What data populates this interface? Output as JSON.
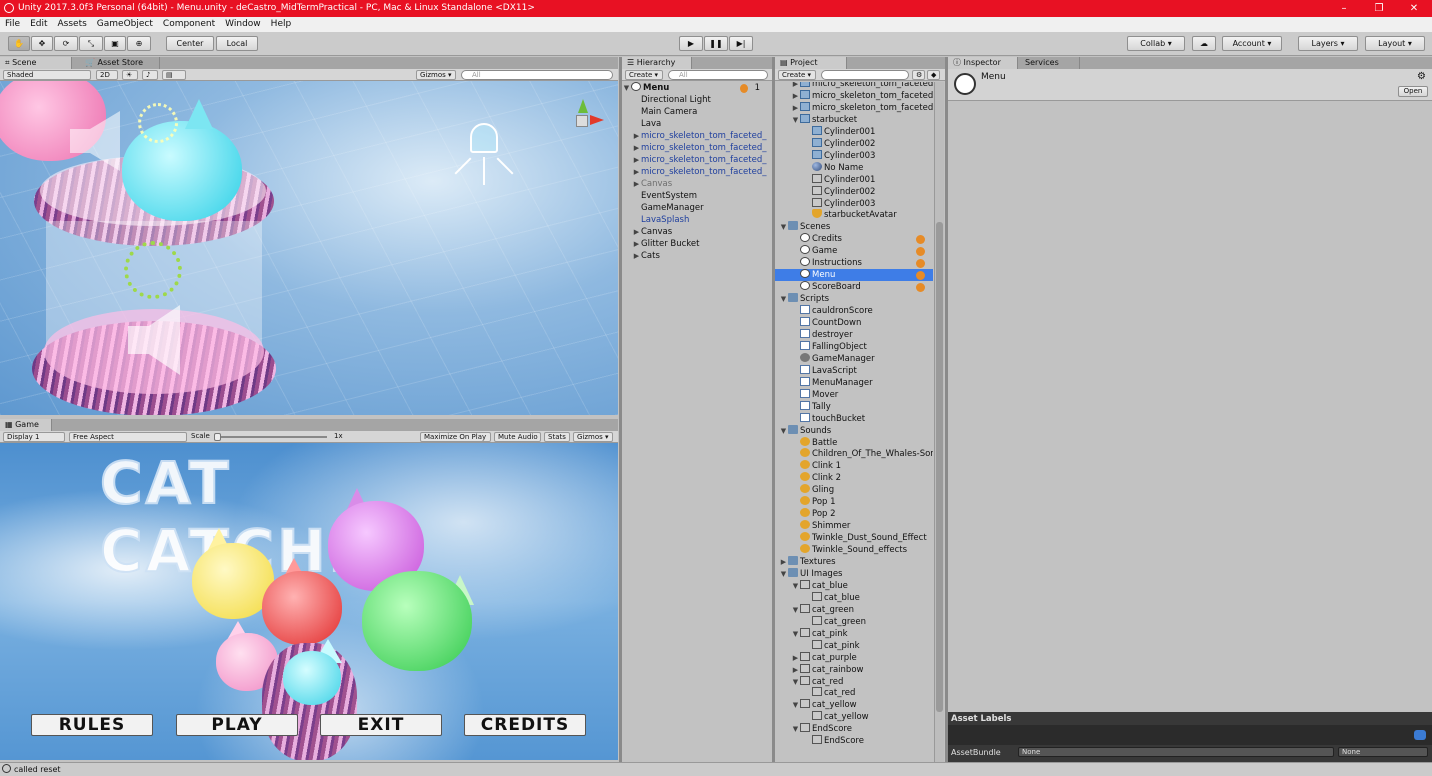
{
  "window": {
    "title": "Unity 2017.3.0f3 Personal (64bit) - Menu.unity - deCastro_MidTermPractical - PC, Mac & Linux Standalone <DX11>",
    "controls": [
      "–",
      "❐",
      "✕"
    ]
  },
  "menubar": [
    "File",
    "Edit",
    "Assets",
    "GameObject",
    "Component",
    "Window",
    "Help"
  ],
  "toolbar": {
    "tools": [
      "hand-tool",
      "move-tool",
      "rotate-tool",
      "scale-tool",
      "rect-tool",
      "transform-tool"
    ],
    "pivot": "Center",
    "space": "Local",
    "collab": "Collab ▾",
    "account": "Account ▾",
    "layers": "Layers ▾",
    "layout": "Layout ▾",
    "play": "▶",
    "pause": "❚❚",
    "step": "▶|"
  },
  "scene": {
    "tab": "Scene",
    "tab2": "Asset Store",
    "shading": "Shaded",
    "mode2d": "2D",
    "gizmos": "Gizmos ▾",
    "search": "All"
  },
  "game": {
    "tab": "Game",
    "display": "Display 1",
    "aspect": "Free Aspect",
    "scale_label": "Scale",
    "scale_value": "1x",
    "max": "Maximize On Play",
    "mute": "Mute Audio",
    "stats": "Stats",
    "gizmos": "Gizmos ▾",
    "title": "CAT CATCHER",
    "buttons": [
      "RULES",
      "PLAY",
      "EXIT",
      "CREDITS"
    ]
  },
  "hierarchy": {
    "tab": "Hierarchy",
    "create": "Create ▾",
    "search": "All",
    "scene": "Menu",
    "scene_badge": "1",
    "items": [
      {
        "label": "Directional Light",
        "indent": 1,
        "arrow": "",
        "style": ""
      },
      {
        "label": "Main Camera",
        "indent": 1,
        "arrow": "",
        "style": ""
      },
      {
        "label": "Lava",
        "indent": 1,
        "arrow": "",
        "style": ""
      },
      {
        "label": "micro_skeleton_tom_faceted_",
        "indent": 1,
        "arrow": "▶",
        "style": "prefab"
      },
      {
        "label": "micro_skeleton_tom_faceted_",
        "indent": 1,
        "arrow": "▶",
        "style": "prefab"
      },
      {
        "label": "micro_skeleton_tom_faceted_",
        "indent": 1,
        "arrow": "▶",
        "style": "prefab"
      },
      {
        "label": "micro_skeleton_tom_faceted_",
        "indent": 1,
        "arrow": "▶",
        "style": "prefab"
      },
      {
        "label": "Canvas",
        "indent": 1,
        "arrow": "▶",
        "style": "disabled"
      },
      {
        "label": "EventSystem",
        "indent": 1,
        "arrow": "",
        "style": ""
      },
      {
        "label": "GameManager",
        "indent": 1,
        "arrow": "",
        "style": ""
      },
      {
        "label": "LavaSplash",
        "indent": 1,
        "arrow": "",
        "style": "prefab"
      },
      {
        "label": "Canvas",
        "indent": 1,
        "arrow": "▶",
        "style": ""
      },
      {
        "label": "Glitter Bucket",
        "indent": 1,
        "arrow": "▶",
        "style": ""
      },
      {
        "label": "Cats",
        "indent": 1,
        "arrow": "▶",
        "style": ""
      }
    ]
  },
  "project": {
    "tab": "Project",
    "create": "Create ▾",
    "search": "",
    "items": [
      {
        "label": "micro_skeleton_tom_faceted",
        "indent": 1,
        "arrow": "▶",
        "icon": "cube"
      },
      {
        "label": "micro_skeleton_tom_faceted",
        "indent": 1,
        "arrow": "▶",
        "icon": "cube"
      },
      {
        "label": "micro_skeleton_tom_faceted",
        "indent": 1,
        "arrow": "▶",
        "icon": "cube"
      },
      {
        "label": "starbucket",
        "indent": 1,
        "arrow": "▼",
        "icon": "cube"
      },
      {
        "label": "Cylinder001",
        "indent": 2,
        "arrow": "",
        "icon": "cube"
      },
      {
        "label": "Cylinder002",
        "indent": 2,
        "arrow": "",
        "icon": "cube"
      },
      {
        "label": "Cylinder003",
        "indent": 2,
        "arrow": "",
        "icon": "cube"
      },
      {
        "label": "No Name",
        "indent": 2,
        "arrow": "",
        "icon": "sphere"
      },
      {
        "label": "Cylinder001",
        "indent": 2,
        "arrow": "",
        "icon": "img"
      },
      {
        "label": "Cylinder002",
        "indent": 2,
        "arrow": "",
        "icon": "img"
      },
      {
        "label": "Cylinder003",
        "indent": 2,
        "arrow": "",
        "icon": "img"
      },
      {
        "label": "starbucketAvatar",
        "indent": 2,
        "arrow": "",
        "icon": "avatar"
      },
      {
        "label": "Scenes",
        "indent": 0,
        "arrow": "▼",
        "icon": "folder"
      },
      {
        "label": "Credits",
        "indent": 1,
        "arrow": "",
        "icon": "unity",
        "badge": true
      },
      {
        "label": "Game",
        "indent": 1,
        "arrow": "",
        "icon": "unity",
        "badge": true
      },
      {
        "label": "Instructions",
        "indent": 1,
        "arrow": "",
        "icon": "unity",
        "badge": true
      },
      {
        "label": "Menu",
        "indent": 1,
        "arrow": "",
        "icon": "unity",
        "badge": true,
        "selected": true
      },
      {
        "label": "ScoreBoard",
        "indent": 1,
        "arrow": "",
        "icon": "unity",
        "badge": true
      },
      {
        "label": "Scripts",
        "indent": 0,
        "arrow": "▼",
        "icon": "folder"
      },
      {
        "label": "cauldronScore",
        "indent": 1,
        "arrow": "",
        "icon": "script"
      },
      {
        "label": "CountDown",
        "indent": 1,
        "arrow": "",
        "icon": "script"
      },
      {
        "label": "destroyer",
        "indent": 1,
        "arrow": "",
        "icon": "script"
      },
      {
        "label": "FallingObject",
        "indent": 1,
        "arrow": "",
        "icon": "script"
      },
      {
        "label": "GameManager",
        "indent": 1,
        "arrow": "",
        "icon": "gear"
      },
      {
        "label": "LavaScript",
        "indent": 1,
        "arrow": "",
        "icon": "script"
      },
      {
        "label": "MenuManager",
        "indent": 1,
        "arrow": "",
        "icon": "script"
      },
      {
        "label": "Mover",
        "indent": 1,
        "arrow": "",
        "icon": "script"
      },
      {
        "label": "Tally",
        "indent": 1,
        "arrow": "",
        "icon": "script"
      },
      {
        "label": "touchBucket",
        "indent": 1,
        "arrow": "",
        "icon": "script"
      },
      {
        "label": "Sounds",
        "indent": 0,
        "arrow": "▼",
        "icon": "folder"
      },
      {
        "label": "Battle",
        "indent": 1,
        "arrow": "",
        "icon": "audio"
      },
      {
        "label": "Children_Of_The_Whales-Sor",
        "indent": 1,
        "arrow": "",
        "icon": "audio"
      },
      {
        "label": "Clink 1",
        "indent": 1,
        "arrow": "",
        "icon": "audio"
      },
      {
        "label": "Clink 2",
        "indent": 1,
        "arrow": "",
        "icon": "audio"
      },
      {
        "label": "Gling",
        "indent": 1,
        "arrow": "",
        "icon": "audio"
      },
      {
        "label": "Pop 1",
        "indent": 1,
        "arrow": "",
        "icon": "audio"
      },
      {
        "label": "Pop 2",
        "indent": 1,
        "arrow": "",
        "icon": "audio"
      },
      {
        "label": "Shimmer",
        "indent": 1,
        "arrow": "",
        "icon": "audio"
      },
      {
        "label": "Twinkle_Dust_Sound_Effect",
        "indent": 1,
        "arrow": "",
        "icon": "audio"
      },
      {
        "label": "Twinkle_Sound_effects",
        "indent": 1,
        "arrow": "",
        "icon": "audio"
      },
      {
        "label": "Textures",
        "indent": 0,
        "arrow": "▶",
        "icon": "folder"
      },
      {
        "label": "UI Images",
        "indent": 0,
        "arrow": "▼",
        "icon": "folder"
      },
      {
        "label": "cat_blue",
        "indent": 1,
        "arrow": "▼",
        "icon": "img"
      },
      {
        "label": "cat_blue",
        "indent": 2,
        "arrow": "",
        "icon": "img"
      },
      {
        "label": "cat_green",
        "indent": 1,
        "arrow": "▼",
        "icon": "img"
      },
      {
        "label": "cat_green",
        "indent": 2,
        "arrow": "",
        "icon": "img"
      },
      {
        "label": "cat_pink",
        "indent": 1,
        "arrow": "▼",
        "icon": "img"
      },
      {
        "label": "cat_pink",
        "indent": 2,
        "arrow": "",
        "icon": "img"
      },
      {
        "label": "cat_purple",
        "indent": 1,
        "arrow": "▶",
        "icon": "img"
      },
      {
        "label": "cat_rainbow",
        "indent": 1,
        "arrow": "▶",
        "icon": "img"
      },
      {
        "label": "cat_red",
        "indent": 1,
        "arrow": "▼",
        "icon": "img"
      },
      {
        "label": "cat_red",
        "indent": 2,
        "arrow": "",
        "icon": "img"
      },
      {
        "label": "cat_yellow",
        "indent": 1,
        "arrow": "▼",
        "icon": "img"
      },
      {
        "label": "cat_yellow",
        "indent": 2,
        "arrow": "",
        "icon": "img"
      },
      {
        "label": "EndScore",
        "indent": 1,
        "arrow": "▼",
        "icon": "img"
      },
      {
        "label": "EndScore",
        "indent": 2,
        "arrow": "",
        "icon": "img"
      }
    ]
  },
  "inspector": {
    "tab": "Inspector",
    "tab2": "Services",
    "object": "Menu",
    "open": "Open",
    "asset_labels": "Asset Labels",
    "asset_bundle": "AssetBundle",
    "bundle_value": "None",
    "variant_value": "None"
  },
  "status": {
    "message": "called reset"
  },
  "colors": {
    "title_red": "#e81123",
    "selection_blue": "#3e7de7",
    "prefab_blue": "#1f3f9e"
  }
}
